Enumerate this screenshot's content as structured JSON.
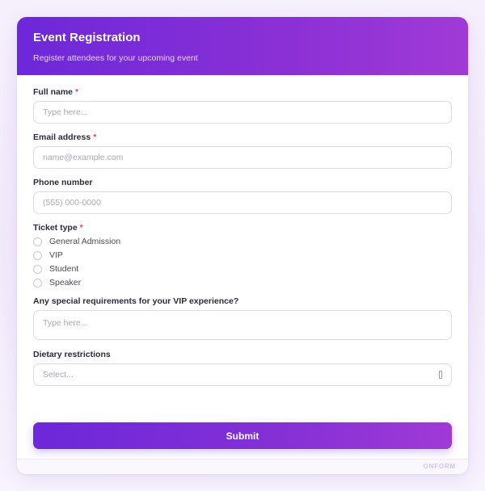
{
  "form": {
    "title": "Event Registration",
    "subtitle": "Register attendees for your upcoming event",
    "required_mark": "*"
  },
  "fields": {
    "full_name": {
      "label": "Full name",
      "placeholder": "Type here..."
    },
    "email": {
      "label": "Email address",
      "placeholder": "name@example.com"
    },
    "phone": {
      "label": "Phone number",
      "placeholder": "(555) 000-0000"
    },
    "ticket": {
      "label": "Ticket type",
      "options": [
        "General Admission",
        "VIP",
        "Student",
        "Speaker"
      ]
    },
    "vip_requirements": {
      "label": "Any special requirements for your VIP experience?",
      "placeholder": "Type here..."
    },
    "dietary": {
      "label": "Dietary restrictions",
      "placeholder": "Select..."
    }
  },
  "actions": {
    "submit_label": "Submit"
  },
  "footer": {
    "brand": "ONFORM"
  },
  "colors": {
    "accent_start": "#6d28d9",
    "accent_end": "#a03ad6",
    "required": "#e5484d"
  }
}
